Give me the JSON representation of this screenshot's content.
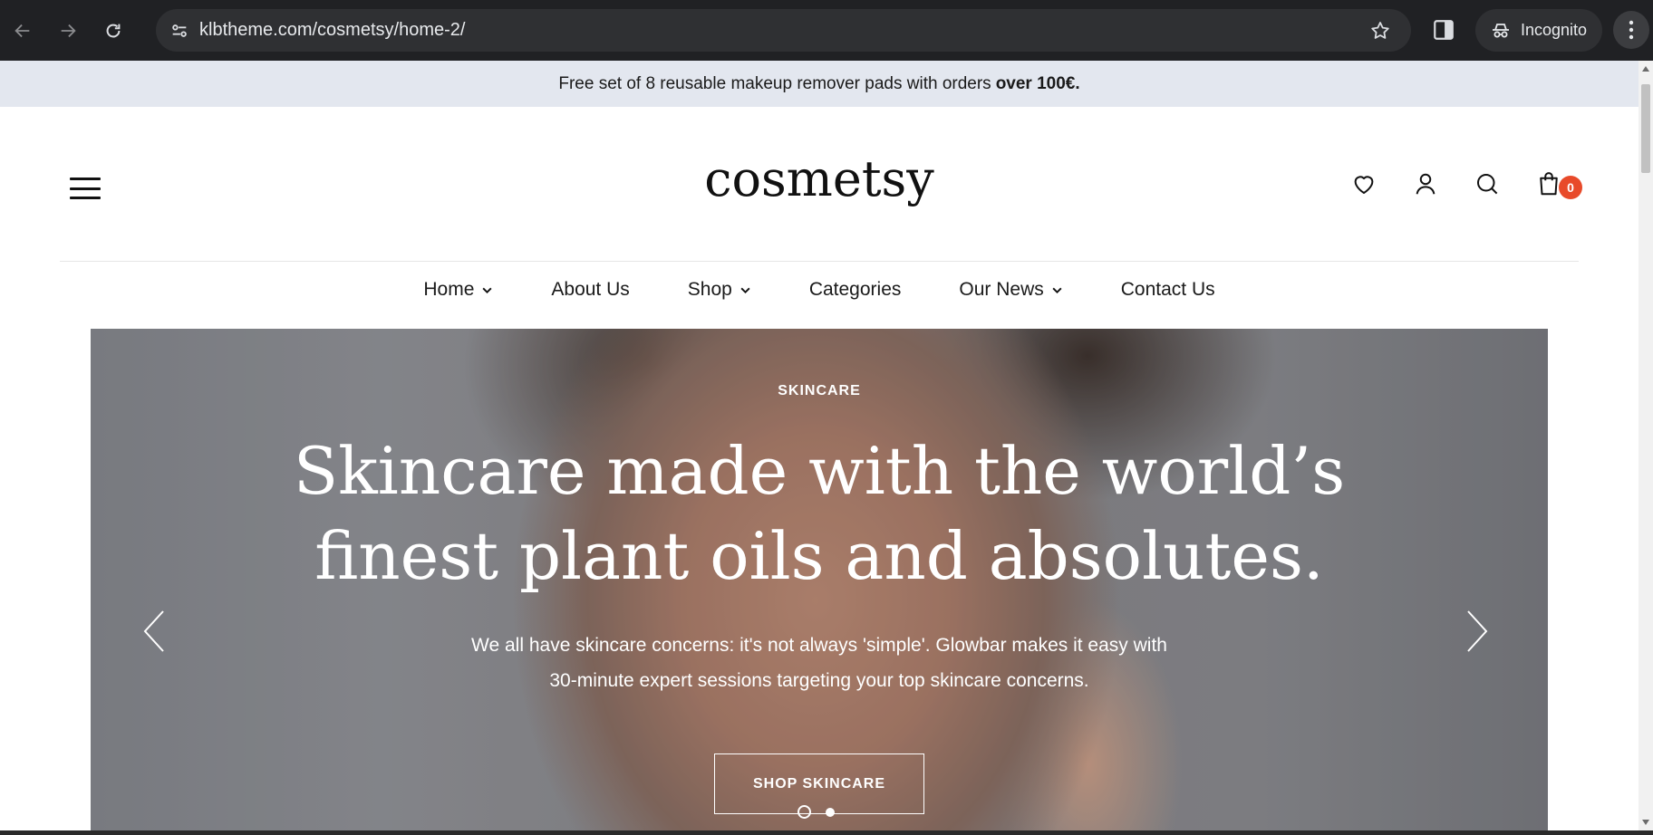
{
  "browser": {
    "url": "klbtheme.com/cosmetsy/home-2/",
    "incognito_label": "Incognito"
  },
  "announcement": {
    "text": "Free set of 8 reusable makeup remover pads with orders",
    "bold": "over 100€."
  },
  "header": {
    "logo": "cosmetsy",
    "cart_count": "0"
  },
  "nav": {
    "items": [
      {
        "label": "Home",
        "dropdown": true
      },
      {
        "label": "About Us",
        "dropdown": false
      },
      {
        "label": "Shop",
        "dropdown": true
      },
      {
        "label": "Categories",
        "dropdown": false
      },
      {
        "label": "Our News",
        "dropdown": true
      },
      {
        "label": "Contact Us",
        "dropdown": false
      }
    ]
  },
  "hero": {
    "eyebrow": "SKINCARE",
    "headline_line1": "Skincare made with the world’s",
    "headline_line2": "finest plant oils and absolutes.",
    "subtext_line1": "We all have skincare concerns: it's not always 'simple'. Glowbar makes it easy with",
    "subtext_line2": "30-minute expert sessions targeting your top skincare concerns.",
    "cta_label": "SHOP SKINCARE",
    "slides_total": 2,
    "active_slide": 1
  },
  "colors": {
    "announcement_bg": "#e3e7ef",
    "badge": "#e84a2a",
    "chrome_bg": "#202124"
  }
}
